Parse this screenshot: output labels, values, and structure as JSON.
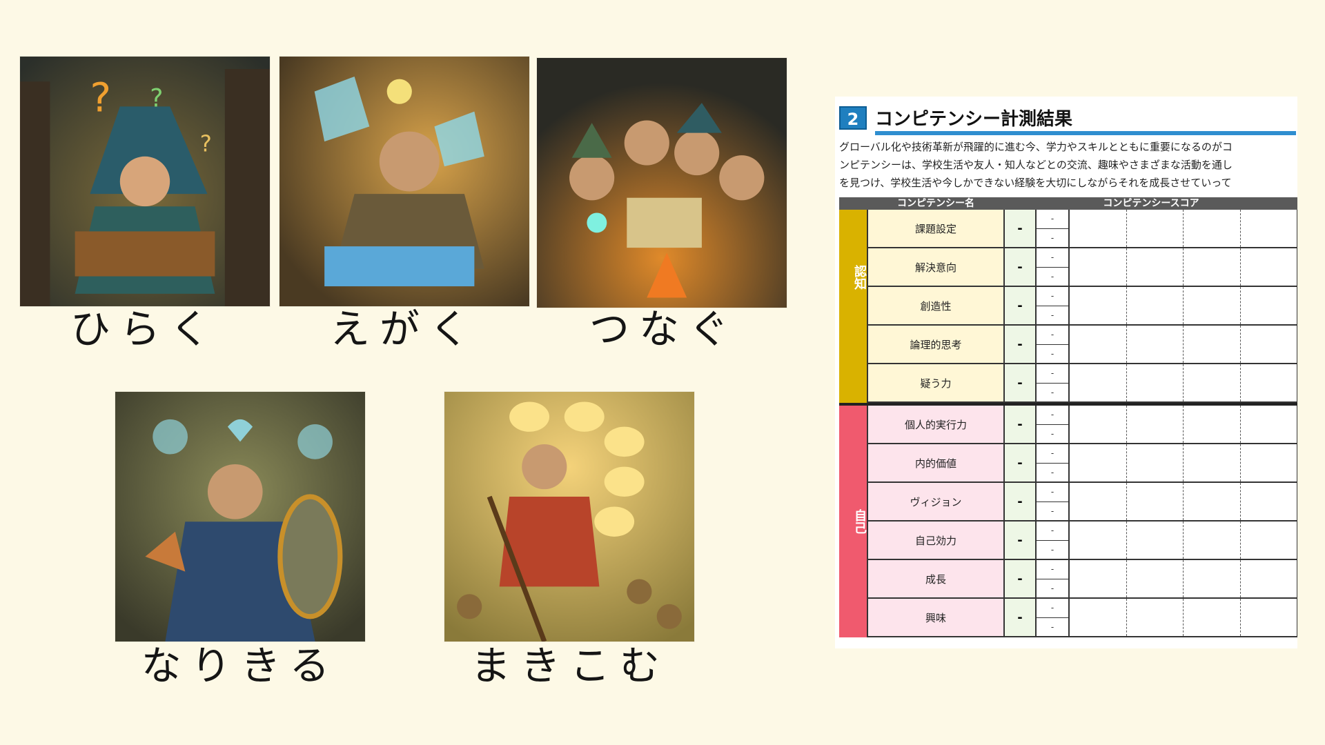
{
  "captions": [
    "ひらく",
    "えがく",
    "つなぐ",
    "なりきる",
    "まきこむ"
  ],
  "sheet": {
    "number": "2",
    "title": "コンピテンシー計測結果",
    "intro_lines": [
      "グローバル化や技術革新が飛躍的に進む今、学力やスキルとともに重要になるのがコ",
      "ンピテンシーは、学校生活や友人・知人などとの交流、趣味やさまざまな活動を通し",
      "を見つけ、学校生活や今しかできない経験を大切にしながらそれを成長させていって"
    ],
    "header_name": "コンピテンシー名",
    "header_score": "コンピテンシースコア",
    "groups": [
      {
        "label": "認知",
        "color": "#d9b200",
        "light": "#fff7d6",
        "items": [
          "課題設定",
          "解決意向",
          "創造性",
          "論理的思考",
          "疑う力"
        ]
      },
      {
        "label": "自己",
        "color": "#f05a6e",
        "light": "#fde4ec",
        "items": [
          "個人的実行力",
          "内的価値",
          "ヴィジョン",
          "自己効力",
          "成長",
          "興味"
        ]
      }
    ],
    "score_placeholder": "-",
    "mini_placeholder": "-"
  },
  "colors": {
    "background": "#fdf9e6",
    "accent_blue": "#1f7fbf"
  }
}
